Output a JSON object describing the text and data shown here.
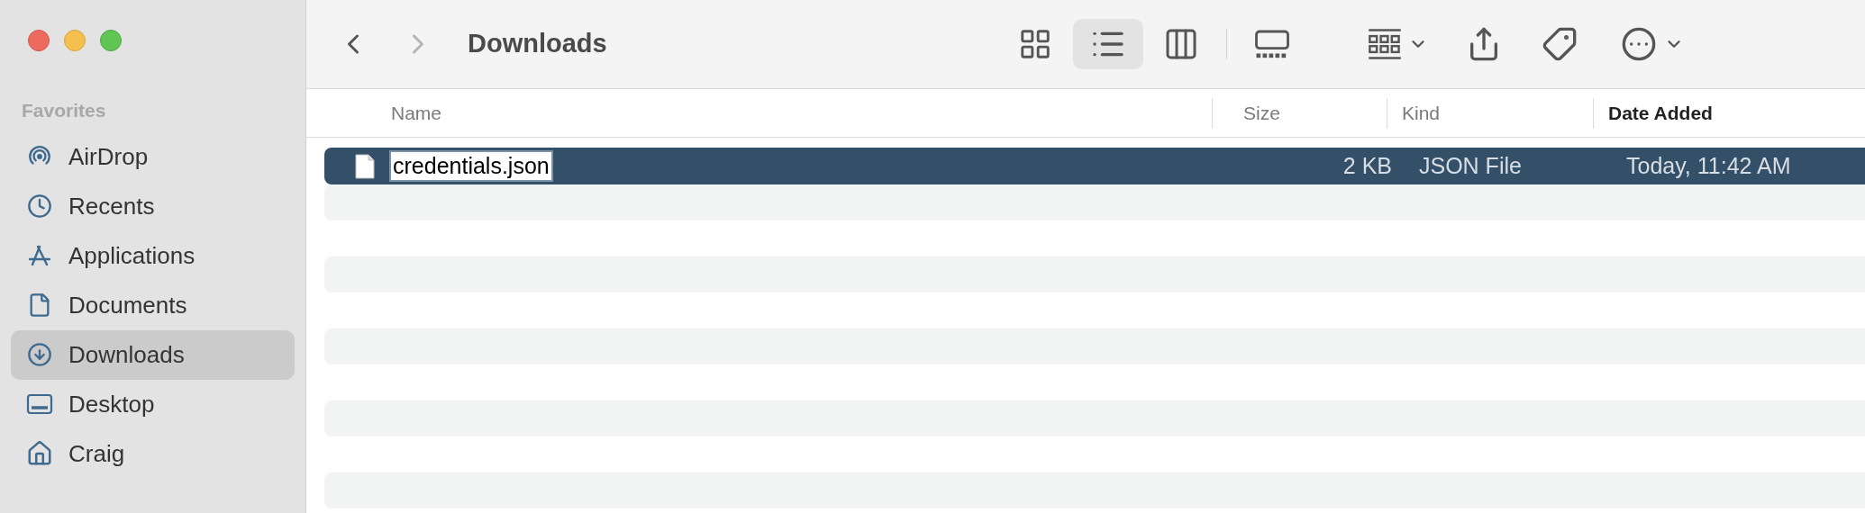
{
  "window": {
    "title": "Downloads"
  },
  "sidebar": {
    "section": "Favorites",
    "items": [
      {
        "label": "AirDrop",
        "selected": false
      },
      {
        "label": "Recents",
        "selected": false
      },
      {
        "label": "Applications",
        "selected": false
      },
      {
        "label": "Documents",
        "selected": false
      },
      {
        "label": "Downloads",
        "selected": true
      },
      {
        "label": "Desktop",
        "selected": false
      },
      {
        "label": "Craig",
        "selected": false
      }
    ]
  },
  "view_buttons": [
    {
      "kind": "icons",
      "selected": false
    },
    {
      "kind": "list",
      "selected": true
    },
    {
      "kind": "columns",
      "selected": false
    },
    {
      "kind": "gallery",
      "selected": false
    }
  ],
  "table": {
    "columns": [
      {
        "label": "Name",
        "sorted": false
      },
      {
        "label": "Size",
        "sorted": false
      },
      {
        "label": "Kind",
        "sorted": false
      },
      {
        "label": "Date Added",
        "sorted": true
      }
    ],
    "rows": [
      {
        "name": "credentials.json",
        "size": "2 KB",
        "kind": "JSON File",
        "date_added": "Today, 11:42 AM",
        "selected": true,
        "editing": true
      }
    ]
  }
}
